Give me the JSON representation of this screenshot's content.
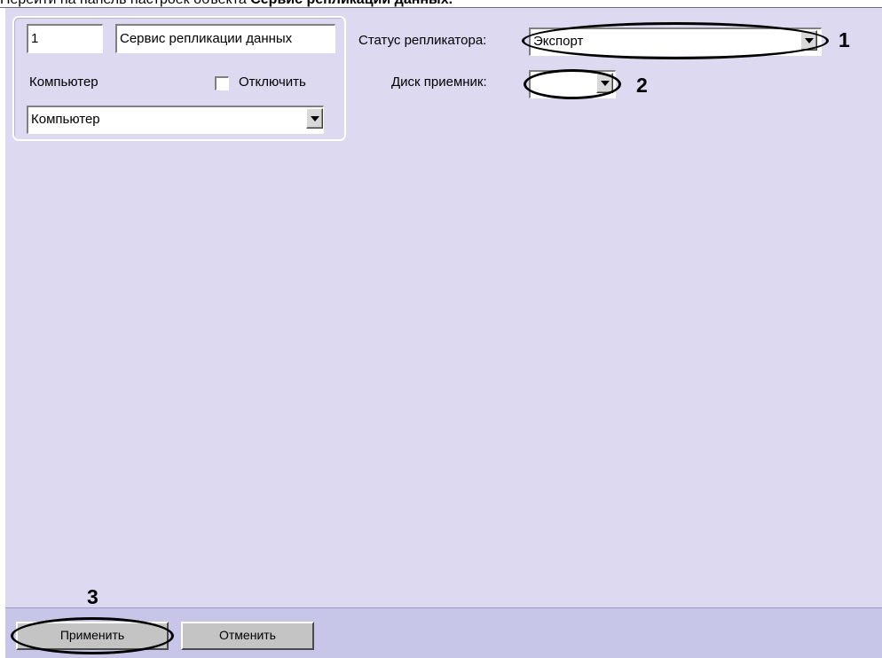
{
  "caption": {
    "prefix": "Перейти на панель настроек объекта ",
    "object_name": "Сервис репликации данных."
  },
  "object_props": {
    "id_value": "1",
    "name_value": "Сервис репликации данных",
    "computer_label": "Компьютер",
    "disable_label": "Отключить",
    "disable_checked": false,
    "computer_value": "Компьютер"
  },
  "settings": {
    "status_label": "Статус репликатора:",
    "status_value": "Экспорт",
    "disk_label": "Диск приемник:",
    "disk_value": ""
  },
  "callouts": {
    "one": "1",
    "two": "2",
    "three": "3"
  },
  "buttons": {
    "apply": "Применить",
    "cancel": "Отменить"
  },
  "colors": {
    "panel_bg": "#dcd9f1",
    "bottom_bar_bg": "#c8c6e8",
    "button_bg": "#c4c4c4"
  }
}
